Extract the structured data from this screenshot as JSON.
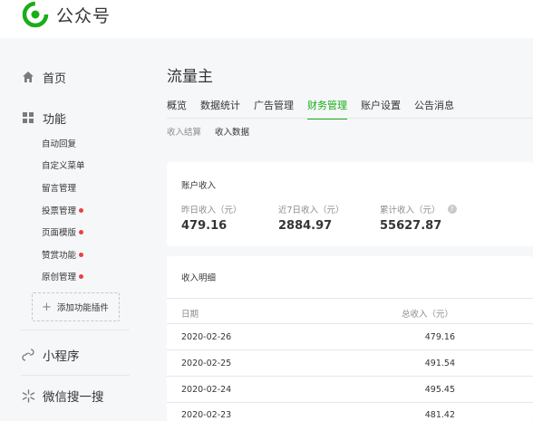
{
  "brand": {
    "name": "公众号",
    "logo_icon": "wechat-mp-logo-icon",
    "accent": "#1aad19"
  },
  "sidebar": {
    "home": {
      "label": "首页",
      "icon": "home-icon"
    },
    "features": {
      "label": "功能",
      "icon": "grid-icon",
      "items": [
        {
          "label": "自动回复",
          "dot": false
        },
        {
          "label": "自定义菜单",
          "dot": false
        },
        {
          "label": "留言管理",
          "dot": false
        },
        {
          "label": "投票管理",
          "dot": true
        },
        {
          "label": "页面模版",
          "dot": true
        },
        {
          "label": "赞赏功能",
          "dot": true
        },
        {
          "label": "原创管理",
          "dot": true
        }
      ],
      "add_plugin": "添加功能插件"
    },
    "miniprogram": {
      "label": "小程序",
      "icon": "link-icon"
    },
    "search": {
      "label": "微信搜一搜",
      "icon": "sparkle-icon"
    }
  },
  "main": {
    "title": "流量主",
    "tabs": [
      "概览",
      "数据统计",
      "广告管理",
      "财务管理",
      "账户设置",
      "公告消息"
    ],
    "active_tab": "财务管理",
    "subtabs": [
      "收入结算",
      "收入数据"
    ],
    "active_subtab": "收入数据",
    "account": {
      "title": "账户收入",
      "stats": [
        {
          "label": "昨日收入（元）",
          "value": "479.16"
        },
        {
          "label": "近7日收入（元）",
          "value": "2884.97"
        },
        {
          "label": "累计收入（元）",
          "value": "55627.87",
          "help": true
        }
      ]
    },
    "details": {
      "title": "收入明细",
      "columns": [
        "日期",
        "总收入（元）"
      ],
      "rows": [
        [
          "2020-02-26",
          "479.16"
        ],
        [
          "2020-02-25",
          "491.54"
        ],
        [
          "2020-02-24",
          "495.45"
        ],
        [
          "2020-02-23",
          "481.42"
        ]
      ]
    }
  }
}
